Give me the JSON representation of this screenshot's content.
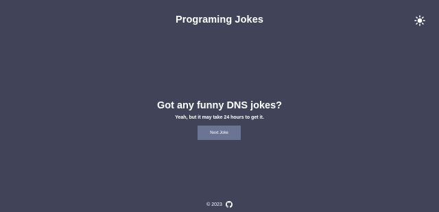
{
  "header": {
    "title": "Programing Jokes",
    "theme_icon": "sun-icon"
  },
  "joke": {
    "setup": "Got any funny DNS jokes?",
    "punchline": "Yeah, but it may take 24 hours to get it."
  },
  "actions": {
    "next_label": "Next Joke"
  },
  "footer": {
    "copyright": "© 2023",
    "icon": "github-icon"
  },
  "colors": {
    "background": "#414458",
    "button": "#6b7493",
    "text": "#ffffff"
  }
}
